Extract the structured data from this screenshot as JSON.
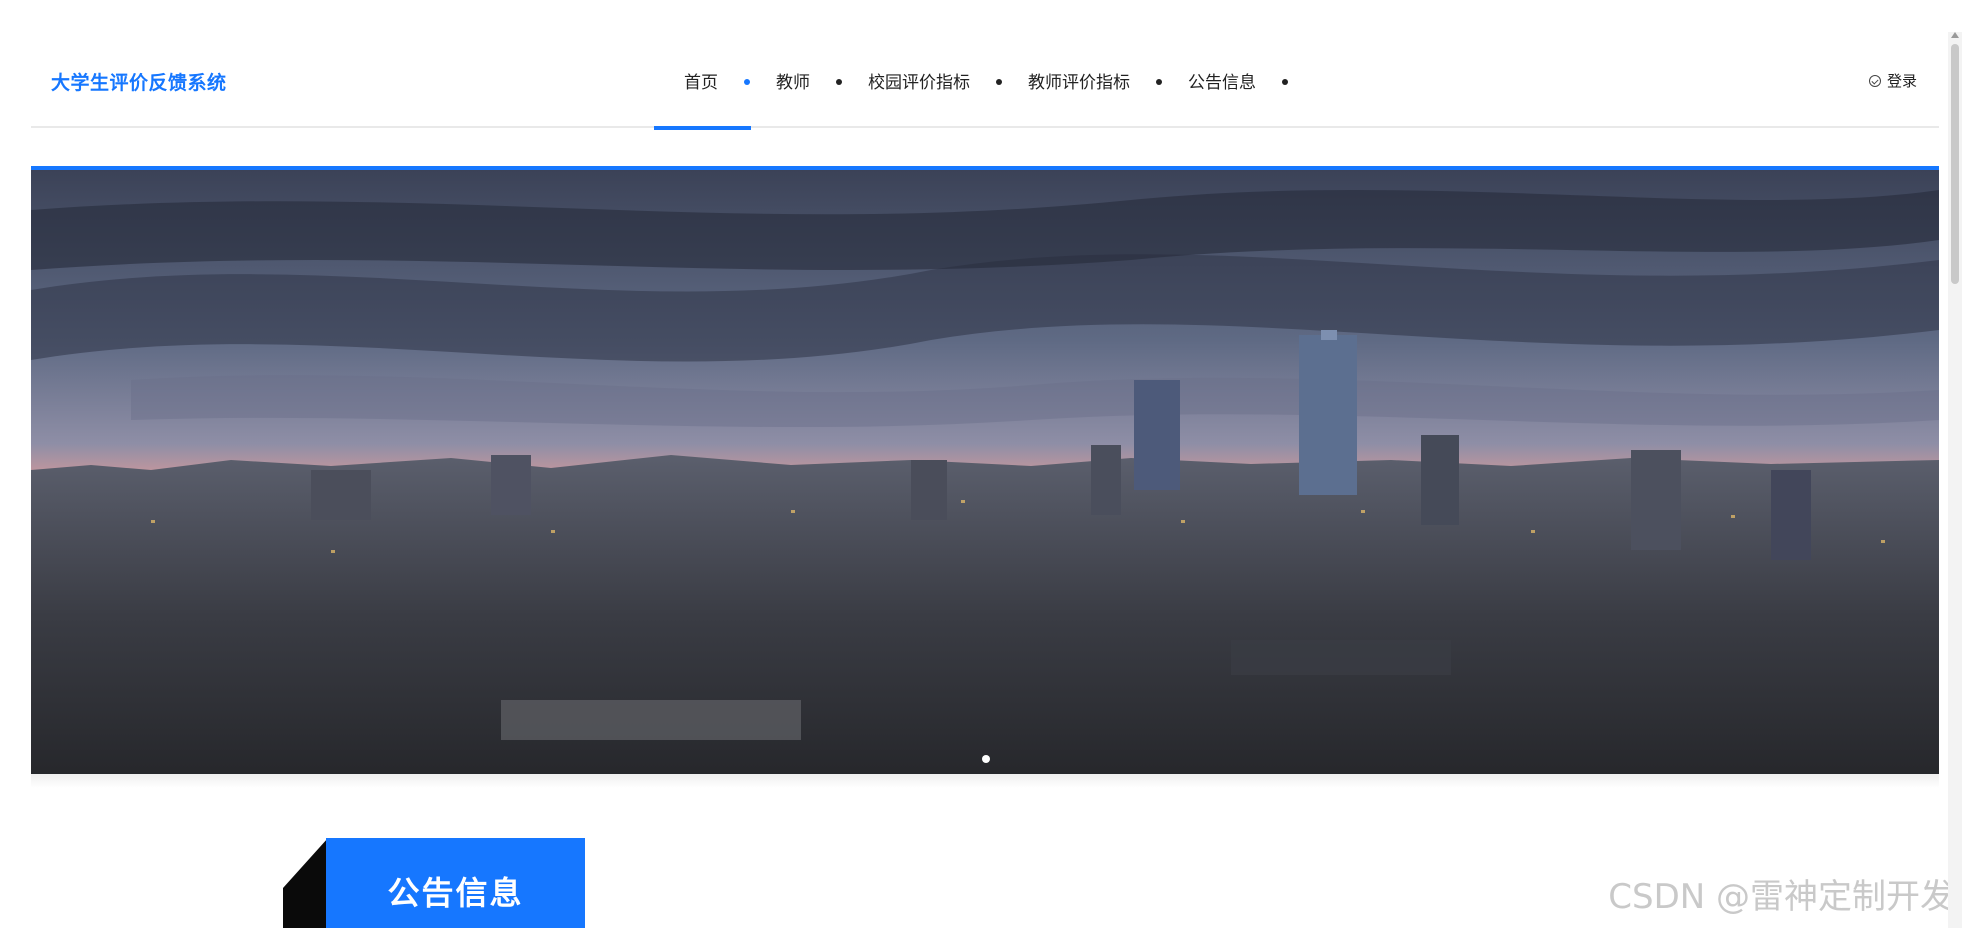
{
  "header": {
    "brand": "大学生评价反馈系统",
    "nav": [
      {
        "label": "首页",
        "active": true
      },
      {
        "label": "教师",
        "active": false
      },
      {
        "label": "校园评价指标",
        "active": false
      },
      {
        "label": "教师评价指标",
        "active": false
      },
      {
        "label": "公告信息",
        "active": false
      }
    ],
    "login_label": "登录"
  },
  "colors": {
    "accent": "#1677ff"
  },
  "banner": {
    "image": "city-skyline-sunset",
    "slides": 1,
    "active_slide": 1
  },
  "section": {
    "title": "公告信息"
  },
  "watermark": "CSDN @雷神定制开发"
}
